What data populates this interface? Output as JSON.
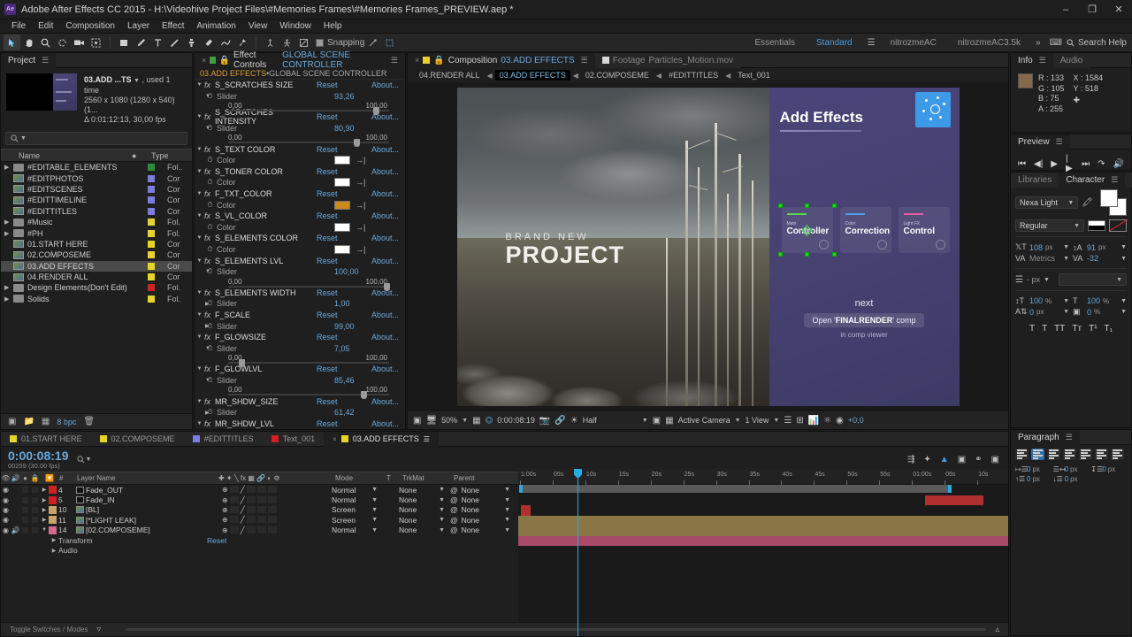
{
  "window": {
    "title": "Adobe After Effects CC 2015 - H:\\Videohive Project Files\\#Memories Frames\\#Memories Frames_PREVIEW.aep *",
    "logo": "Ae",
    "minimize": "–",
    "maximize": "❐",
    "close": "✕"
  },
  "menubar": [
    "File",
    "Edit",
    "Composition",
    "Layer",
    "Effect",
    "Animation",
    "View",
    "Window",
    "Help"
  ],
  "toolbar": {
    "snapping_label": "Snapping",
    "workspaces": [
      "Essentials",
      "Standard",
      "nitrozmeAC",
      "nitrozmeAC3.5k"
    ],
    "selected_workspace": "Standard",
    "overflow": "»",
    "search_help": "Search Help"
  },
  "project": {
    "tab": "Project",
    "item_name": "03.ADD ...TS",
    "used": ", used 1 time",
    "resolution": "2560 x 1080  (1280 x 540) (1...",
    "duration": "Δ 0:01:12:13, 30,00 fps",
    "search_placeholder": "",
    "columns": [
      "Name",
      "Type"
    ],
    "items": [
      {
        "name": "#EDITABLE_ELEMENTS",
        "kind": "folder",
        "label": "#2e8b3a",
        "type": "Fol..",
        "expand": "▶"
      },
      {
        "name": "#EDITPHOTOS",
        "kind": "comp",
        "label": "#7b7be0",
        "type": "Cor",
        "expand": ""
      },
      {
        "name": "#EDITSCENES",
        "kind": "comp",
        "label": "#7b7be0",
        "type": "Cor",
        "expand": ""
      },
      {
        "name": "#EDITTIMELINE",
        "kind": "comp",
        "label": "#7b7be0",
        "type": "Cor",
        "expand": ""
      },
      {
        "name": "#EDITTITLES",
        "kind": "comp",
        "label": "#7b7be0",
        "type": "Cor",
        "expand": ""
      },
      {
        "name": "#Music",
        "kind": "folder",
        "label": "#e8d32a",
        "type": "Fol.",
        "expand": "▶"
      },
      {
        "name": "#PH",
        "kind": "folder",
        "label": "#e8d32a",
        "type": "Fol.",
        "expand": "▶"
      },
      {
        "name": "01.START HERE",
        "kind": "comp",
        "label": "#e8d32a",
        "type": "Cor",
        "expand": ""
      },
      {
        "name": "02.COMPOSEME",
        "kind": "comp",
        "label": "#e8d32a",
        "type": "Cor",
        "expand": ""
      },
      {
        "name": "03.ADD EFFECTS",
        "kind": "comp",
        "label": "#e8d32a",
        "type": "Cor",
        "expand": "",
        "selected": true
      },
      {
        "name": "04.RENDER ALL",
        "kind": "comp",
        "label": "#e8d32a",
        "type": "Cor",
        "expand": ""
      },
      {
        "name": "Design Elements(Don't Edit)",
        "kind": "folder",
        "label": "#d02222",
        "type": "Fol.",
        "expand": "▶"
      },
      {
        "name": "Solids",
        "kind": "folder",
        "label": "#e8d32a",
        "type": "Fol.",
        "expand": "▶"
      }
    ],
    "bpc": "8 bpc"
  },
  "effect_controls": {
    "tab": "Effect Controls",
    "tab_target": "GLOBAL SCENE CONTROLLER",
    "subtitle_comp": "03.ADD EFFECTS",
    "subtitle_sep": " • ",
    "subtitle_layer": "GLOBAL SCENE CONTROLLER",
    "reset_label": "Reset",
    "about_label": "About...",
    "slider_label": "Slider",
    "color_label": "Color",
    "effects": [
      {
        "name": "S_SCRATCHES SIZE",
        "param": "slider",
        "value": "93,26",
        "min": "0,00",
        "max": "100,00",
        "pct": 93.26,
        "expanded": true
      },
      {
        "name": "S_SCRATCHES INTENSITY",
        "param": "slider",
        "value": "80,90",
        "min": "0,00",
        "max": "100,00",
        "pct": 80.9,
        "expanded": true
      },
      {
        "name": "S_TEXT COLOR",
        "param": "color",
        "swatch": "#ffffff"
      },
      {
        "name": "S_TONER COLOR",
        "param": "color",
        "swatch": "#ffffff"
      },
      {
        "name": "F_TXT_COLOR",
        "param": "color",
        "swatch": "#c98a1a"
      },
      {
        "name": "S_VL_COLOR",
        "param": "color",
        "swatch": "#ffffff"
      },
      {
        "name": "S_ELEMENTS COLOR",
        "param": "color",
        "swatch": "#ffffff"
      },
      {
        "name": "S_ELEMENTS LVL",
        "param": "slider",
        "value": "100,00",
        "min": "0,00",
        "max": "100,00",
        "pct": 100,
        "expanded": true
      },
      {
        "name": "S_ELEMENTS WIDTH",
        "param": "slider-collapsed",
        "value": "1,00"
      },
      {
        "name": "F_SCALE",
        "param": "slider-collapsed",
        "value": "99,00"
      },
      {
        "name": "F_GLOWSIZE",
        "param": "slider",
        "value": "7,05",
        "min": "0,00",
        "max": "100,00",
        "pct": 7.05,
        "expanded": true
      },
      {
        "name": "F_GLOWLVL",
        "param": "slider",
        "value": "85,46",
        "min": "0,00",
        "max": "100,00",
        "pct": 85.46,
        "expanded": true
      },
      {
        "name": "MR_SHDW_SIZE",
        "param": "slider-collapsed",
        "value": "61,42"
      },
      {
        "name": "MR_SHDW_LVL",
        "param": "none",
        "value": ""
      }
    ]
  },
  "composition": {
    "tab_label": "Composition",
    "tab_name": "03.ADD EFFECTS",
    "tab2_label": "Footage",
    "tab2_name": "Particles_Motion.mov",
    "breadcrumbs": [
      "04.RENDER ALL",
      "03.ADD EFFECTS",
      "02.COMPOSEME",
      "#EDITTITLES",
      "Text_001"
    ],
    "active_breadcrumb": "03.ADD EFFECTS",
    "preview_text_small": "BRAND NEW",
    "preview_text_big": "PROJECT",
    "slide": {
      "title": "Add Effects",
      "cards": [
        {
          "kicker": "Main",
          "title": "Controller",
          "bar": "#5ad65a"
        },
        {
          "kicker": "Color",
          "title": "Correction",
          "bar": "#4a9fe8"
        },
        {
          "kicker": "Light FX",
          "title": "Control",
          "bar": "#e85a9f"
        }
      ],
      "next_label": "next",
      "next_action_prefix": "Open '",
      "next_action_bold": "FINALRENDER",
      "next_action_suffix": "' comp",
      "next_sub": "in comp viewer"
    },
    "bottom_bar": {
      "zoom": "50%",
      "time": "0:00:08:19",
      "resolution": "Half",
      "camera": "Active Camera",
      "views": "1 View",
      "exposure": "+0,0"
    }
  },
  "info": {
    "tab": "Info",
    "tab2": "Audio",
    "r": "R : 133",
    "g": "G : 105",
    "b": "B : 75",
    "a": "A : 255",
    "x": "X : 1584",
    "y": "Y : 518",
    "swatch": "#85694b"
  },
  "preview": {
    "tab": "Preview"
  },
  "character": {
    "tab": "Character",
    "tab_libraries": "Libraries",
    "font_family": "Nexa Light",
    "font_style": "Regular",
    "size": "108",
    "size_unit": "px",
    "leading": "91",
    "leading_unit": "px",
    "kerning": "Metrics",
    "tracking": "-32",
    "stroke_width": "- px",
    "vscale": "100",
    "vscale_unit": "%",
    "hscale": "100",
    "hscale_unit": "%",
    "baseline": "0",
    "baseline_unit": "px",
    "tsume": "0",
    "tsume_unit": "%",
    "styles": [
      "T",
      "T",
      "TT",
      "Tт",
      "T¹",
      "T₁"
    ]
  },
  "paragraph": {
    "tab": "Paragraph",
    "indent_left": "0",
    "indent_right": "0",
    "indent_first": "0",
    "space_before": "0",
    "space_after": "0",
    "unit": "px"
  },
  "timeline": {
    "tabs": [
      {
        "name": "01.START HERE",
        "color": "#e8d32a"
      },
      {
        "name": "02.COMPOSEME",
        "color": "#e8d32a"
      },
      {
        "name": "#EDITTITLES",
        "color": "#7b7be0"
      },
      {
        "name": "Text_001",
        "color": "#d02222"
      },
      {
        "name": "03.ADD EFFECTS",
        "color": "#e8d32a",
        "active": true
      }
    ],
    "current_time": "0:00:08:19",
    "frame_info": "00259 (30.00 fps)",
    "columns": [
      "#",
      "Layer Name",
      "Mode",
      "T",
      "TrkMat",
      "Parent"
    ],
    "layers": [
      {
        "num": "4",
        "name": "Fade_OUT",
        "label": "#d02222",
        "mode": "Normal",
        "trkmat": "None",
        "parent": "None",
        "icon": "solid",
        "eye": true,
        "audio": false,
        "clip_color": "#b03030",
        "clip_start": 83,
        "clip_width": 12
      },
      {
        "num": "5",
        "name": "Fade_IN",
        "label": "#d02222",
        "mode": "Normal",
        "trkmat": "None",
        "parent": "None",
        "icon": "solid",
        "eye": true,
        "audio": false,
        "clip_color": "#b03030",
        "clip_start": 0.5,
        "clip_width": 2
      },
      {
        "num": "10",
        "name": "[BL]",
        "label": "#caa36b",
        "mode": "Screen",
        "trkmat": "None",
        "parent": "None",
        "icon": "comp",
        "eye": true,
        "audio": false,
        "clip_color": "#8a7546",
        "clip_start": 0,
        "clip_width": 100
      },
      {
        "num": "11",
        "name": "[*LIGHT LEAK]",
        "label": "#caa36b",
        "mode": "Screen",
        "trkmat": "None",
        "parent": "None",
        "icon": "comp",
        "eye": true,
        "audio": false,
        "clip_color": "#8a7546",
        "clip_start": 0,
        "clip_width": 100
      },
      {
        "num": "14",
        "name": "[02.COMPOSEME]",
        "label": "#d46a8c",
        "mode": "Normal",
        "trkmat": "None",
        "parent": "None",
        "icon": "comp",
        "eye": true,
        "audio": true,
        "clip_color": "#a64a68",
        "clip_start": 0,
        "clip_width": 100
      }
    ],
    "sub_rows": [
      {
        "name": "Transform",
        "value": "Reset"
      },
      {
        "name": "Audio",
        "value": ""
      }
    ],
    "ruler_ticks": [
      "1:00s",
      "05s",
      "10s",
      "15s",
      "20s",
      "25s",
      "30s",
      "35s",
      "40s",
      "45s",
      "50s",
      "55s",
      "01:00s",
      "05s",
      "10s"
    ],
    "toggle_label": "Toggle Switches / Modes"
  }
}
